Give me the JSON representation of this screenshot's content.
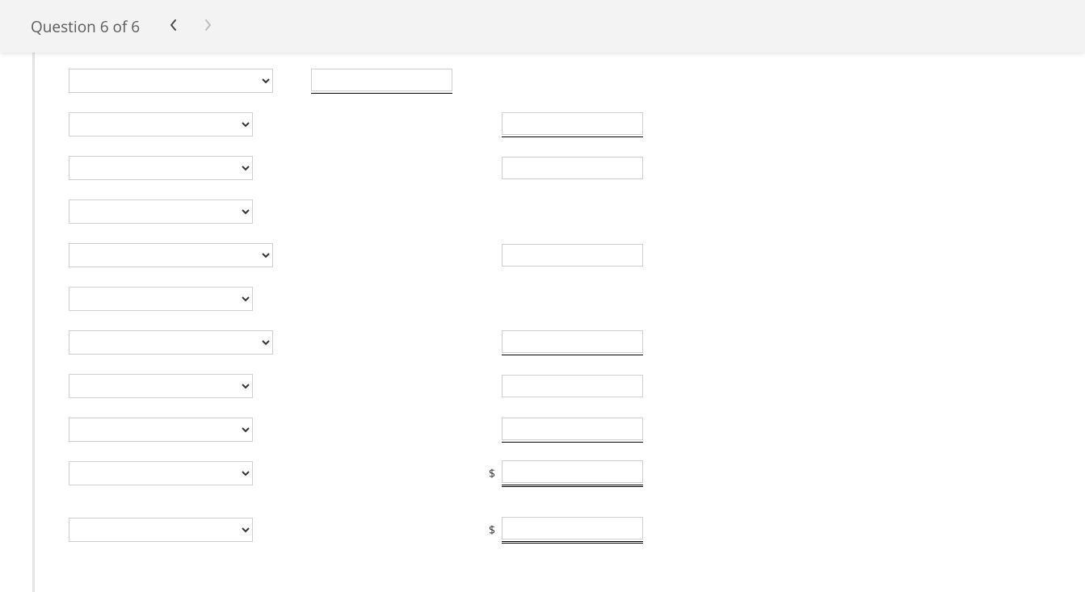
{
  "header": {
    "question_label": "Question 6 of 6"
  },
  "currency_symbol": "$",
  "rows": [
    {
      "left_sel_w": "w253",
      "mid_input": true,
      "mid_underline": true,
      "right_input": false
    },
    {
      "left_sel_w": "w228",
      "mid_input": false,
      "right_input": true,
      "right_underline": true
    },
    {
      "left_sel_w": "w228",
      "mid_input": false,
      "right_input": true
    },
    {
      "left_sel_w": "w228",
      "mid_input": false,
      "right_input": false
    },
    {
      "left_sel_w": "w253",
      "mid_input": false,
      "right_input": true
    },
    {
      "left_sel_w": "w228",
      "mid_input": false,
      "right_input": false
    },
    {
      "left_sel_w": "w253",
      "mid_input": false,
      "right_input": true,
      "right_underline": true
    },
    {
      "left_sel_w": "w228",
      "mid_input": false,
      "right_input": true
    },
    {
      "left_sel_w": "w228",
      "mid_input": false,
      "right_input": true,
      "right_underline": true
    },
    {
      "left_sel_w": "w228",
      "mid_input": false,
      "right_input": true,
      "right_dollar": true,
      "right_dbl_underline": true,
      "gap_after": true
    },
    {
      "left_sel_w": "w228",
      "mid_input": false,
      "right_input": true,
      "right_dollar": true,
      "right_dbl_underline": true
    }
  ]
}
